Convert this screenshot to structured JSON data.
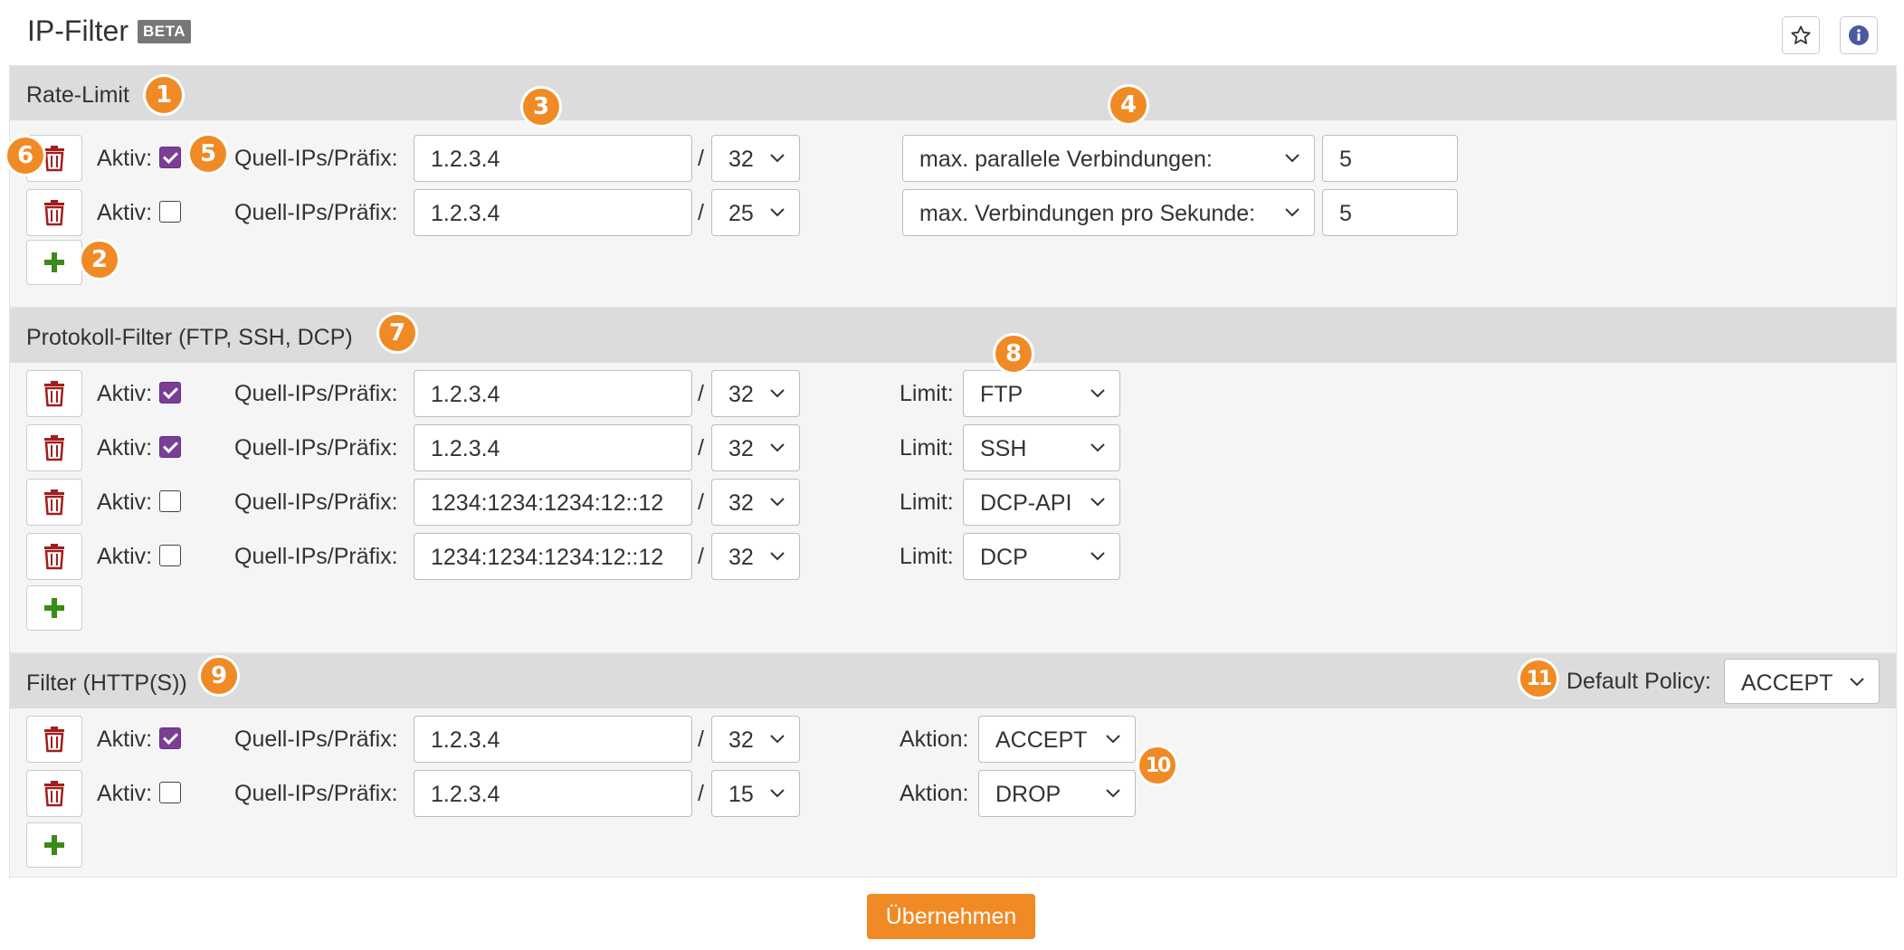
{
  "header": {
    "title": "IP-Filter",
    "beta": "BETA"
  },
  "common": {
    "aktiv": "Aktiv:",
    "quell": "Quell-IPs/Präfix:",
    "slash": "/",
    "limit": "Limit:",
    "aktion": "Aktion:"
  },
  "rate_limit": {
    "title": "Rate-Limit",
    "rows": [
      {
        "active": true,
        "ip": "1.2.3.4",
        "prefix": "32",
        "type": "max. parallele Verbindungen:",
        "value": "5"
      },
      {
        "active": false,
        "ip": "1.2.3.4",
        "prefix": "25",
        "type": "max. Verbindungen pro Sekunde:",
        "value": "5"
      }
    ]
  },
  "protocol_filter": {
    "title": "Protokoll-Filter (FTP, SSH, DCP)",
    "rows": [
      {
        "active": true,
        "ip": "1.2.3.4",
        "prefix": "32",
        "limit": "FTP"
      },
      {
        "active": true,
        "ip": "1.2.3.4",
        "prefix": "32",
        "limit": "SSH"
      },
      {
        "active": false,
        "ip": "1234:1234:1234:12::12",
        "prefix": "32",
        "limit": "DCP-API"
      },
      {
        "active": false,
        "ip": "1234:1234:1234:12::12",
        "prefix": "32",
        "limit": "DCP"
      }
    ]
  },
  "http_filter": {
    "title": "Filter (HTTP(S))",
    "default_policy_label": "Default Policy:",
    "default_policy": "ACCEPT",
    "rows": [
      {
        "active": true,
        "ip": "1.2.3.4",
        "prefix": "32",
        "action": "ACCEPT"
      },
      {
        "active": false,
        "ip": "1.2.3.4",
        "prefix": "15",
        "action": "DROP"
      }
    ]
  },
  "badges": [
    "1",
    "2",
    "3",
    "4",
    "5",
    "6",
    "7",
    "8",
    "9",
    "10",
    "11"
  ],
  "submit_label": "Übernehmen",
  "colors": {
    "accent": "#f08a24",
    "checkbox": "#7a3e97",
    "trash": "#a31d1d",
    "plus": "#3a8a1a",
    "section_header": "#dcdcdc"
  },
  "icons": [
    "star-icon",
    "info-icon",
    "trash-icon",
    "plus-icon",
    "chevron-down-icon"
  ]
}
